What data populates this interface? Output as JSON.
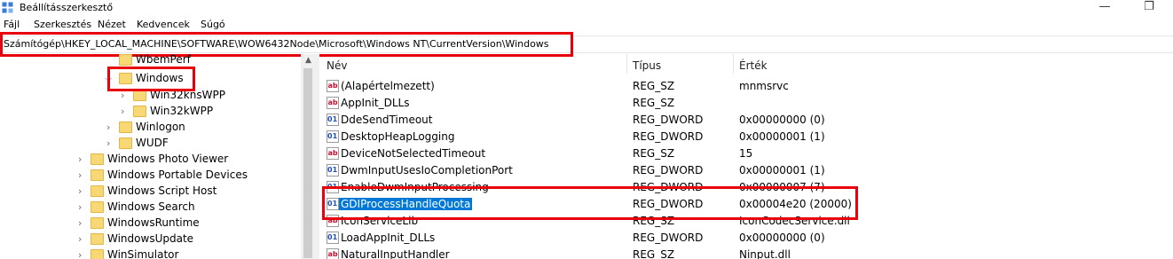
{
  "window": {
    "title": "Beállításszerkesztő",
    "app_icon": "regedit-icon",
    "controls": [
      "minimize-icon",
      "maximize-icon"
    ]
  },
  "menu": [
    "Fájl",
    "Szerkesztés",
    "Nézet",
    "Kedvencek",
    "Súgó"
  ],
  "address": {
    "path": "Számítógép\\HKEY_LOCAL_MACHINE\\SOFTWARE\\WOW6432Node\\Microsoft\\Windows NT\\CurrentVersion\\Windows"
  },
  "tree": {
    "items": [
      {
        "label": "WbemPerf",
        "chevron": "",
        "highlighted": false
      },
      {
        "label": "Windows",
        "chevron": "⌵",
        "highlighted": true
      },
      {
        "label": "Win32knsWPP",
        "chevron": "›",
        "highlighted": false
      },
      {
        "label": "Win32kWPP",
        "chevron": "›",
        "highlighted": false
      },
      {
        "label": "Winlogon",
        "chevron": "›",
        "highlighted": false
      },
      {
        "label": "WUDF",
        "chevron": "›",
        "highlighted": false
      },
      {
        "label": "Windows Photo Viewer",
        "chevron": "›",
        "highlighted": false
      },
      {
        "label": "Windows Portable Devices",
        "chevron": "›",
        "highlighted": false
      },
      {
        "label": "Windows Script Host",
        "chevron": "›",
        "highlighted": false
      },
      {
        "label": "Windows Search",
        "chevron": "›",
        "highlighted": false
      },
      {
        "label": "WindowsRuntime",
        "chevron": "›",
        "highlighted": false
      },
      {
        "label": "WindowsUpdate",
        "chevron": "›",
        "highlighted": false
      },
      {
        "label": "WinSimulator",
        "chevron": "›",
        "highlighted": false
      }
    ]
  },
  "list": {
    "columns": {
      "name": "Név",
      "type": "Típus",
      "data": "Érték"
    },
    "rows": [
      {
        "name": "(Alapértelmezett)",
        "type": "REG_SZ",
        "data": "mnmsrvc",
        "icon": "string-value-icon",
        "selected": false
      },
      {
        "name": "AppInit_DLLs",
        "type": "REG_SZ",
        "data": "",
        "icon": "string-value-icon",
        "selected": false
      },
      {
        "name": "DdeSendTimeout",
        "type": "REG_DWORD",
        "data": "0x00000000 (0)",
        "icon": "dword-value-icon",
        "selected": false
      },
      {
        "name": "DesktopHeapLogging",
        "type": "REG_DWORD",
        "data": "0x00000001 (1)",
        "icon": "dword-value-icon",
        "selected": false
      },
      {
        "name": "DeviceNotSelectedTimeout",
        "type": "REG_SZ",
        "data": "15",
        "icon": "string-value-icon",
        "selected": false
      },
      {
        "name": "DwmInputUsesIoCompletionPort",
        "type": "REG_DWORD",
        "data": "0x00000001 (1)",
        "icon": "dword-value-icon",
        "selected": false
      },
      {
        "name": "EnableDwmInputProcessing",
        "type": "REG_DWORD",
        "data": "0x00000007 (7)",
        "icon": "dword-value-icon",
        "selected": false
      },
      {
        "name": "GDIProcessHandleQuota",
        "type": "REG_DWORD",
        "data": "0x00004e20 (20000)",
        "icon": "dword-value-icon",
        "selected": true
      },
      {
        "name": "IconServiceLib",
        "type": "REG_SZ",
        "data": "IconCodecService.dll",
        "icon": "string-value-icon",
        "selected": false
      },
      {
        "name": "LoadAppInit_DLLs",
        "type": "REG_DWORD",
        "data": "0x00000000 (0)",
        "icon": "dword-value-icon",
        "selected": false
      },
      {
        "name": "NaturalInputHandler",
        "type": "REG_SZ",
        "data": "Ninput.dll",
        "icon": "string-value-icon",
        "selected": false
      }
    ]
  },
  "icons": {
    "string_value_glyph": "ab",
    "dword_value_glyph": "011"
  },
  "colors": {
    "highlight_box": "#e8000b",
    "selection": "#0078d7",
    "folder": "#f8d775"
  }
}
